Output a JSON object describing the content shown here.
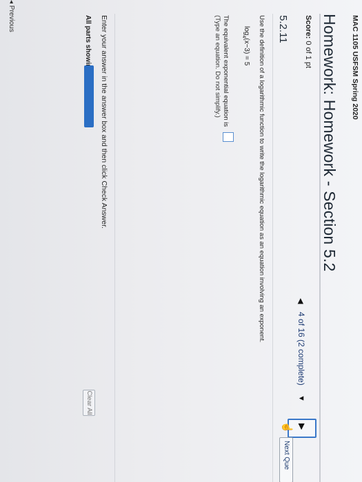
{
  "header": {
    "course": "MAC 1105 USFSM Spring 2020",
    "title": "Homework: Homework - Section 5.2",
    "score_label": "Score:",
    "score_value": "0 of 1 pt"
  },
  "question": {
    "number": "5.2.11",
    "progress": "4 of 16 (2 complete)",
    "next_label": "Next Que",
    "instruction": "Use the definition of a logarithmic function to write the logarithmic equation as an equation involving an exponent.",
    "given_log": "log",
    "given_base": "4",
    "given_rest": "(x−3) = 5",
    "prompt": "The equivalent exponential equation is",
    "hint": "(Type an equation. Do not simplify.)"
  },
  "footer": {
    "enter_message": "Enter your answer in the answer box and then click Check Answer.",
    "parts_label": "All parts showing",
    "clear_all": "Clear All",
    "previous": "◂ Previous"
  },
  "icons": {
    "prev": "triangle-left",
    "next": "triangle-right",
    "dropdown": "triangle-down",
    "cursor": "hand-pointer"
  },
  "colors": {
    "accent": "#2a6ec4",
    "link": "#1d3b73",
    "highlight_border": "#3a78c9"
  }
}
